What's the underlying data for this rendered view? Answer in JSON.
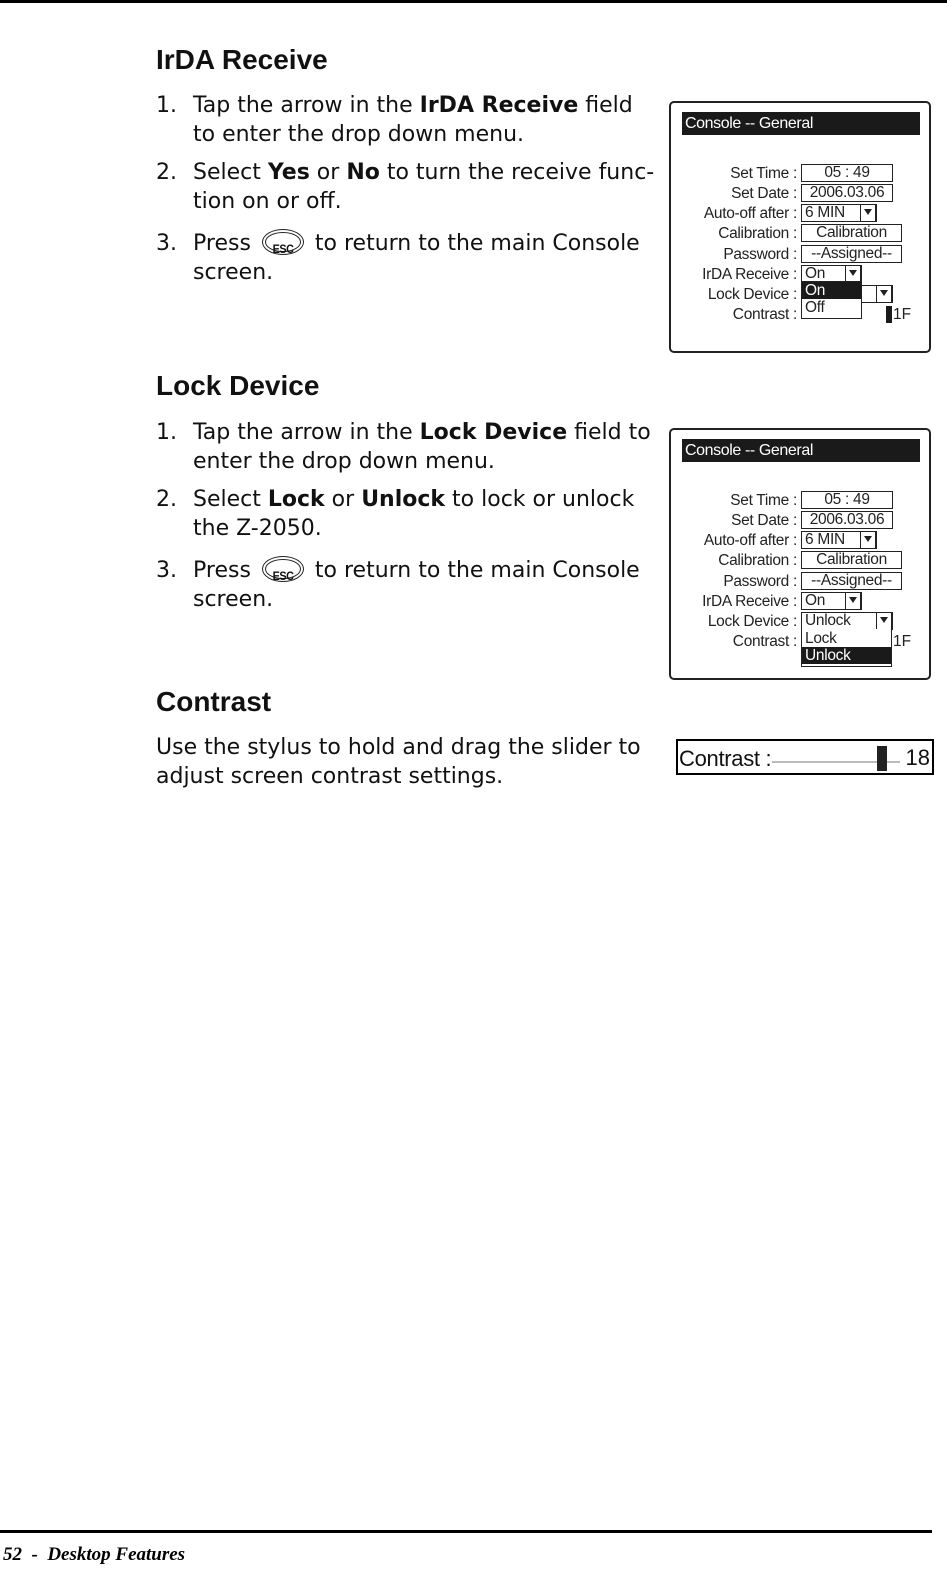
{
  "page": {
    "footer": "52  -  Desktop Features"
  },
  "irda": {
    "heading": "IrDA Receive",
    "steps": [
      {
        "num": "1.",
        "pre": "Tap the arrow in the ",
        "bold": "IrDA Receive",
        "post": " field to enter the drop down menu."
      },
      {
        "num": "2.",
        "pre": "Select ",
        "bold1": "Yes",
        "mid": " or ",
        "bold2": "No",
        "post": " to turn the receive func-tion on or off."
      },
      {
        "num": "3.",
        "pre": "Press",
        "icon": "ESC",
        "post": "to return to the main Console screen."
      }
    ]
  },
  "lock": {
    "heading": "Lock Device",
    "steps": [
      {
        "num": "1.",
        "pre": "Tap the arrow in the ",
        "bold": "Lock Device",
        "post": " field to enter the drop down menu."
      },
      {
        "num": "2.",
        "pre": "Select ",
        "bold1": "Lock",
        "mid": " or ",
        "bold2": "Unlock",
        "post": " to lock or unlock the Z-2050."
      },
      {
        "num": "3.",
        "pre": "Press",
        "icon": "ESC",
        "post": "to return to the main Console screen."
      }
    ]
  },
  "contrast": {
    "heading": "Contrast",
    "text": "Use the stylus to hold and drag the slider to adjust screen contrast settings.",
    "slider": {
      "label": "Contrast :",
      "value": "18",
      "position_fraction": 0.86
    }
  },
  "panel1": {
    "title": "Console -- General",
    "labels": [
      "Set Time :",
      "Set Date :",
      "Auto-off after :",
      "Calibration :",
      "Password :",
      "IrDA Receive :",
      "Lock Device :",
      "Contrast :"
    ],
    "set_time": "05 : 49",
    "set_date": "2006.03.06",
    "auto_off": "6 MIN",
    "calibration": "Calibration",
    "password": "--Assigned--",
    "irda_value": "On",
    "lock_value": "",
    "contrast_value": "1F",
    "dropdown": [
      {
        "label": "On",
        "selected": true
      },
      {
        "label": "Off",
        "selected": false
      }
    ]
  },
  "panel2": {
    "title": "Console -- General",
    "labels": [
      "Set Time :",
      "Set Date :",
      "Auto-off after :",
      "Calibration :",
      "Password :",
      "IrDA Receive :",
      "Lock Device :",
      "Contrast :"
    ],
    "set_time": "05 : 49",
    "set_date": "2006.03.06",
    "auto_off": "6 MIN",
    "calibration": "Calibration",
    "password": "--Assigned--",
    "irda_value": "On",
    "lock_value": "Unlock",
    "contrast_value": "1F",
    "dropdown": [
      {
        "label": "Lock",
        "selected": false
      },
      {
        "label": "Unlock",
        "selected": true
      }
    ]
  }
}
